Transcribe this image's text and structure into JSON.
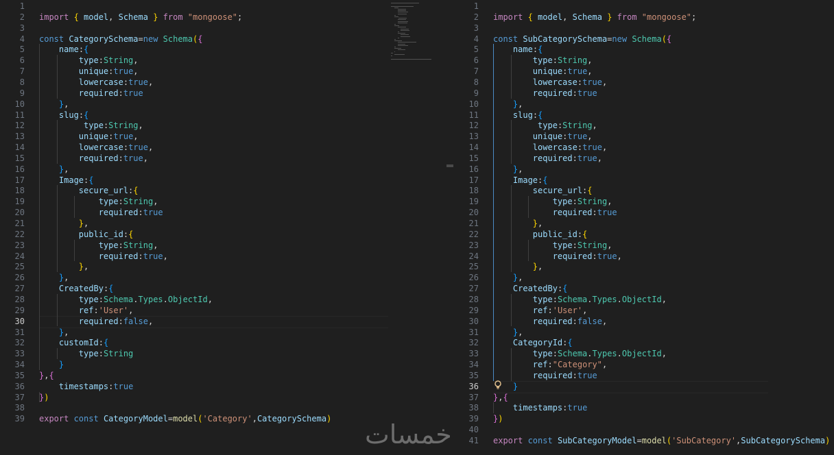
{
  "watermark": "خمسات",
  "left_editor": {
    "active_line": 30,
    "lines": [
      [],
      [
        [
          "c",
          "import "
        ],
        [
          "b1",
          "{ "
        ],
        [
          "v",
          "model"
        ],
        [
          "p",
          ", "
        ],
        [
          "v",
          "Schema"
        ],
        [
          "b1",
          " }"
        ],
        [
          "c",
          " from "
        ],
        [
          "s",
          "\"mongoose\""
        ],
        [
          "p",
          ";"
        ]
      ],
      [],
      [
        [
          "k",
          "const "
        ],
        [
          "v",
          "CategorySchema"
        ],
        [
          "p",
          "="
        ],
        [
          "k",
          "new "
        ],
        [
          "t",
          "Schema"
        ],
        [
          "b1",
          "("
        ],
        [
          "b2",
          "{"
        ]
      ],
      [
        [
          "p",
          "    "
        ],
        [
          "v",
          "name"
        ],
        [
          "p",
          ":"
        ],
        [
          "b3",
          "{"
        ]
      ],
      [
        [
          "p",
          "        "
        ],
        [
          "v",
          "type"
        ],
        [
          "p",
          ":"
        ],
        [
          "t",
          "String"
        ],
        [
          "p",
          ","
        ]
      ],
      [
        [
          "p",
          "        "
        ],
        [
          "v",
          "unique"
        ],
        [
          "p",
          ":"
        ],
        [
          "k",
          "true"
        ],
        [
          "p",
          ","
        ]
      ],
      [
        [
          "p",
          "        "
        ],
        [
          "v",
          "lowercase"
        ],
        [
          "p",
          ":"
        ],
        [
          "k",
          "true"
        ],
        [
          "p",
          ","
        ]
      ],
      [
        [
          "p",
          "        "
        ],
        [
          "v",
          "required"
        ],
        [
          "p",
          ":"
        ],
        [
          "k",
          "true"
        ]
      ],
      [
        [
          "p",
          "    "
        ],
        [
          "b3",
          "}"
        ],
        [
          "p",
          ","
        ]
      ],
      [
        [
          "p",
          "    "
        ],
        [
          "v",
          "slug"
        ],
        [
          "p",
          ":"
        ],
        [
          "b3",
          "{"
        ]
      ],
      [
        [
          "p",
          "         "
        ],
        [
          "v",
          "type"
        ],
        [
          "p",
          ":"
        ],
        [
          "t",
          "String"
        ],
        [
          "p",
          ","
        ]
      ],
      [
        [
          "p",
          "        "
        ],
        [
          "v",
          "unique"
        ],
        [
          "p",
          ":"
        ],
        [
          "k",
          "true"
        ],
        [
          "p",
          ","
        ]
      ],
      [
        [
          "p",
          "        "
        ],
        [
          "v",
          "lowercase"
        ],
        [
          "p",
          ":"
        ],
        [
          "k",
          "true"
        ],
        [
          "p",
          ","
        ]
      ],
      [
        [
          "p",
          "        "
        ],
        [
          "v",
          "required"
        ],
        [
          "p",
          ":"
        ],
        [
          "k",
          "true"
        ],
        [
          "p",
          ","
        ]
      ],
      [
        [
          "p",
          "    "
        ],
        [
          "b3",
          "}"
        ],
        [
          "p",
          ","
        ]
      ],
      [
        [
          "p",
          "    "
        ],
        [
          "v",
          "Image"
        ],
        [
          "p",
          ":"
        ],
        [
          "b3",
          "{"
        ]
      ],
      [
        [
          "p",
          "        "
        ],
        [
          "v",
          "secure_url"
        ],
        [
          "p",
          ":"
        ],
        [
          "b1",
          "{"
        ]
      ],
      [
        [
          "p",
          "            "
        ],
        [
          "v",
          "type"
        ],
        [
          "p",
          ":"
        ],
        [
          "t",
          "String"
        ],
        [
          "p",
          ","
        ]
      ],
      [
        [
          "p",
          "            "
        ],
        [
          "v",
          "required"
        ],
        [
          "p",
          ":"
        ],
        [
          "k",
          "true"
        ]
      ],
      [
        [
          "p",
          "        "
        ],
        [
          "b1",
          "}"
        ],
        [
          "p",
          ","
        ]
      ],
      [
        [
          "p",
          "        "
        ],
        [
          "v",
          "public_id"
        ],
        [
          "p",
          ":"
        ],
        [
          "b1",
          "{"
        ]
      ],
      [
        [
          "p",
          "            "
        ],
        [
          "v",
          "type"
        ],
        [
          "p",
          ":"
        ],
        [
          "t",
          "String"
        ],
        [
          "p",
          ","
        ]
      ],
      [
        [
          "p",
          "            "
        ],
        [
          "v",
          "required"
        ],
        [
          "p",
          ":"
        ],
        [
          "k",
          "true"
        ],
        [
          "p",
          ","
        ]
      ],
      [
        [
          "p",
          "        "
        ],
        [
          "b1",
          "}"
        ],
        [
          "p",
          ","
        ]
      ],
      [
        [
          "p",
          "    "
        ],
        [
          "b3",
          "}"
        ],
        [
          "p",
          ","
        ]
      ],
      [
        [
          "p",
          "    "
        ],
        [
          "v",
          "CreatedBy"
        ],
        [
          "p",
          ":"
        ],
        [
          "b3",
          "{"
        ]
      ],
      [
        [
          "p",
          "        "
        ],
        [
          "v",
          "type"
        ],
        [
          "p",
          ":"
        ],
        [
          "t",
          "Schema"
        ],
        [
          "p",
          "."
        ],
        [
          "t",
          "Types"
        ],
        [
          "p",
          "."
        ],
        [
          "t",
          "ObjectId"
        ],
        [
          "p",
          ","
        ]
      ],
      [
        [
          "p",
          "        "
        ],
        [
          "v",
          "ref"
        ],
        [
          "p",
          ":"
        ],
        [
          "s",
          "'User'"
        ],
        [
          "p",
          ","
        ]
      ],
      [
        [
          "p",
          "        "
        ],
        [
          "v",
          "required"
        ],
        [
          "p",
          ":"
        ],
        [
          "k",
          "false"
        ],
        [
          "p",
          ","
        ]
      ],
      [
        [
          "p",
          "    "
        ],
        [
          "b3",
          "}"
        ],
        [
          "p",
          ","
        ]
      ],
      [
        [
          "p",
          "    "
        ],
        [
          "v",
          "customId"
        ],
        [
          "p",
          ":"
        ],
        [
          "b3",
          "{"
        ]
      ],
      [
        [
          "p",
          "        "
        ],
        [
          "v",
          "type"
        ],
        [
          "p",
          ":"
        ],
        [
          "t",
          "String"
        ]
      ],
      [
        [
          "p",
          "    "
        ],
        [
          "b3",
          "}"
        ]
      ],
      [
        [
          "b2",
          "}"
        ],
        [
          "p",
          ","
        ],
        [
          "b2",
          "{"
        ]
      ],
      [
        [
          "p",
          "    "
        ],
        [
          "v",
          "timestamps"
        ],
        [
          "p",
          ":"
        ],
        [
          "k",
          "true"
        ]
      ],
      [
        [
          "b2",
          "}"
        ],
        [
          "b1",
          ")"
        ]
      ],
      [],
      [
        [
          "c",
          "export "
        ],
        [
          "k",
          "const "
        ],
        [
          "v",
          "CategoryModel"
        ],
        [
          "p",
          "="
        ],
        [
          "f",
          "model"
        ],
        [
          "b1",
          "("
        ],
        [
          "s",
          "'Category'"
        ],
        [
          "p",
          ","
        ],
        [
          "v",
          "CategorySchema"
        ],
        [
          "b1",
          ")"
        ]
      ]
    ]
  },
  "right_editor": {
    "active_line": 36,
    "lines": [
      [],
      [
        [
          "c",
          "import "
        ],
        [
          "b1",
          "{ "
        ],
        [
          "v",
          "model"
        ],
        [
          "p",
          ", "
        ],
        [
          "v",
          "Schema"
        ],
        [
          "b1",
          " }"
        ],
        [
          "c",
          " from "
        ],
        [
          "s",
          "\"mongoose\""
        ],
        [
          "p",
          ";"
        ]
      ],
      [],
      [
        [
          "k",
          "const "
        ],
        [
          "v",
          "SubCategorySchema"
        ],
        [
          "p",
          "="
        ],
        [
          "k",
          "new "
        ],
        [
          "t",
          "Schema"
        ],
        [
          "b1",
          "("
        ],
        [
          "b2",
          "{"
        ]
      ],
      [
        [
          "p",
          "    "
        ],
        [
          "v",
          "name"
        ],
        [
          "p",
          ":"
        ],
        [
          "b3",
          "{"
        ]
      ],
      [
        [
          "p",
          "        "
        ],
        [
          "v",
          "type"
        ],
        [
          "p",
          ":"
        ],
        [
          "t",
          "String"
        ],
        [
          "p",
          ","
        ]
      ],
      [
        [
          "p",
          "        "
        ],
        [
          "v",
          "unique"
        ],
        [
          "p",
          ":"
        ],
        [
          "k",
          "true"
        ],
        [
          "p",
          ","
        ]
      ],
      [
        [
          "p",
          "        "
        ],
        [
          "v",
          "lowercase"
        ],
        [
          "p",
          ":"
        ],
        [
          "k",
          "true"
        ],
        [
          "p",
          ","
        ]
      ],
      [
        [
          "p",
          "        "
        ],
        [
          "v",
          "required"
        ],
        [
          "p",
          ":"
        ],
        [
          "k",
          "true"
        ]
      ],
      [
        [
          "p",
          "    "
        ],
        [
          "b3",
          "}"
        ],
        [
          "p",
          ","
        ]
      ],
      [
        [
          "p",
          "    "
        ],
        [
          "v",
          "slug"
        ],
        [
          "p",
          ":"
        ],
        [
          "b3",
          "{"
        ]
      ],
      [
        [
          "p",
          "         "
        ],
        [
          "v",
          "type"
        ],
        [
          "p",
          ":"
        ],
        [
          "t",
          "String"
        ],
        [
          "p",
          ","
        ]
      ],
      [
        [
          "p",
          "        "
        ],
        [
          "v",
          "unique"
        ],
        [
          "p",
          ":"
        ],
        [
          "k",
          "true"
        ],
        [
          "p",
          ","
        ]
      ],
      [
        [
          "p",
          "        "
        ],
        [
          "v",
          "lowercase"
        ],
        [
          "p",
          ":"
        ],
        [
          "k",
          "true"
        ],
        [
          "p",
          ","
        ]
      ],
      [
        [
          "p",
          "        "
        ],
        [
          "v",
          "required"
        ],
        [
          "p",
          ":"
        ],
        [
          "k",
          "true"
        ],
        [
          "p",
          ","
        ]
      ],
      [
        [
          "p",
          "    "
        ],
        [
          "b3",
          "}"
        ],
        [
          "p",
          ","
        ]
      ],
      [
        [
          "p",
          "    "
        ],
        [
          "v",
          "Image"
        ],
        [
          "p",
          ":"
        ],
        [
          "b3",
          "{"
        ]
      ],
      [
        [
          "p",
          "        "
        ],
        [
          "v",
          "secure_url"
        ],
        [
          "p",
          ":"
        ],
        [
          "b1",
          "{"
        ]
      ],
      [
        [
          "p",
          "            "
        ],
        [
          "v",
          "type"
        ],
        [
          "p",
          ":"
        ],
        [
          "t",
          "String"
        ],
        [
          "p",
          ","
        ]
      ],
      [
        [
          "p",
          "            "
        ],
        [
          "v",
          "required"
        ],
        [
          "p",
          ":"
        ],
        [
          "k",
          "true"
        ]
      ],
      [
        [
          "p",
          "        "
        ],
        [
          "b1",
          "}"
        ],
        [
          "p",
          ","
        ]
      ],
      [
        [
          "p",
          "        "
        ],
        [
          "v",
          "public_id"
        ],
        [
          "p",
          ":"
        ],
        [
          "b1",
          "{"
        ]
      ],
      [
        [
          "p",
          "            "
        ],
        [
          "v",
          "type"
        ],
        [
          "p",
          ":"
        ],
        [
          "t",
          "String"
        ],
        [
          "p",
          ","
        ]
      ],
      [
        [
          "p",
          "            "
        ],
        [
          "v",
          "required"
        ],
        [
          "p",
          ":"
        ],
        [
          "k",
          "true"
        ],
        [
          "p",
          ","
        ]
      ],
      [
        [
          "p",
          "        "
        ],
        [
          "b1",
          "}"
        ],
        [
          "p",
          ","
        ]
      ],
      [
        [
          "p",
          "    "
        ],
        [
          "b3",
          "}"
        ],
        [
          "p",
          ","
        ]
      ],
      [
        [
          "p",
          "    "
        ],
        [
          "v",
          "CreatedBy"
        ],
        [
          "p",
          ":"
        ],
        [
          "b3",
          "{"
        ]
      ],
      [
        [
          "p",
          "        "
        ],
        [
          "v",
          "type"
        ],
        [
          "p",
          ":"
        ],
        [
          "t",
          "Schema"
        ],
        [
          "p",
          "."
        ],
        [
          "t",
          "Types"
        ],
        [
          "p",
          "."
        ],
        [
          "t",
          "ObjectId"
        ],
        [
          "p",
          ","
        ]
      ],
      [
        [
          "p",
          "        "
        ],
        [
          "v",
          "ref"
        ],
        [
          "p",
          ":"
        ],
        [
          "s",
          "'User'"
        ],
        [
          "p",
          ","
        ]
      ],
      [
        [
          "p",
          "        "
        ],
        [
          "v",
          "required"
        ],
        [
          "p",
          ":"
        ],
        [
          "k",
          "false"
        ],
        [
          "p",
          ","
        ]
      ],
      [
        [
          "p",
          "    "
        ],
        [
          "b3",
          "}"
        ],
        [
          "p",
          ","
        ]
      ],
      [
        [
          "p",
          "    "
        ],
        [
          "v",
          "CategoryId"
        ],
        [
          "p",
          ":"
        ],
        [
          "b3",
          "{"
        ]
      ],
      [
        [
          "p",
          "        "
        ],
        [
          "v",
          "type"
        ],
        [
          "p",
          ":"
        ],
        [
          "t",
          "Schema"
        ],
        [
          "p",
          "."
        ],
        [
          "t",
          "Types"
        ],
        [
          "p",
          "."
        ],
        [
          "t",
          "ObjectId"
        ],
        [
          "p",
          ","
        ]
      ],
      [
        [
          "p",
          "        "
        ],
        [
          "v",
          "ref"
        ],
        [
          "p",
          ":"
        ],
        [
          "s",
          "\"Category\""
        ],
        [
          "p",
          ","
        ]
      ],
      [
        [
          "p",
          "        "
        ],
        [
          "v",
          "required"
        ],
        [
          "p",
          ":"
        ],
        [
          "k",
          "true"
        ]
      ],
      [
        [
          "p",
          "    "
        ],
        [
          "b3",
          "}"
        ]
      ],
      [
        [
          "b2",
          "}"
        ],
        [
          "p",
          ","
        ],
        [
          "b2",
          "{"
        ]
      ],
      [
        [
          "p",
          "    "
        ],
        [
          "v",
          "timestamps"
        ],
        [
          "p",
          ":"
        ],
        [
          "k",
          "true"
        ]
      ],
      [
        [
          "b2",
          "}"
        ],
        [
          "b1",
          ")"
        ]
      ],
      [],
      [
        [
          "c",
          "export "
        ],
        [
          "k",
          "const "
        ],
        [
          "v",
          "SubCategoryModel"
        ],
        [
          "p",
          "="
        ],
        [
          "f",
          "model"
        ],
        [
          "b1",
          "("
        ],
        [
          "s",
          "'SubCategory'"
        ],
        [
          "p",
          ","
        ],
        [
          "v",
          "SubCategorySchema"
        ],
        [
          "b1",
          ")"
        ]
      ]
    ]
  },
  "icons": {
    "lightbulb": "lightbulb-icon"
  }
}
